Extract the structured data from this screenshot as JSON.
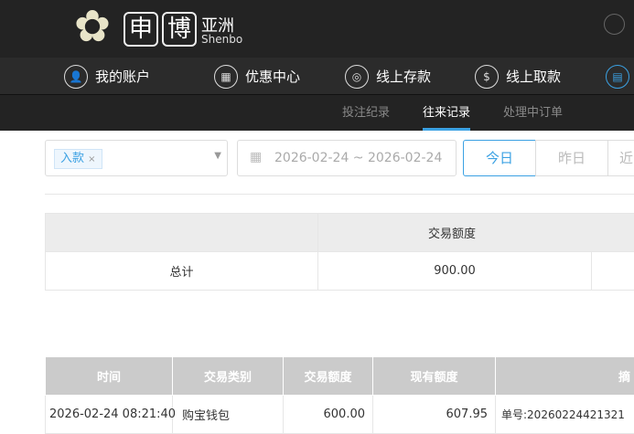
{
  "brand": {
    "logo_char1": "申",
    "logo_char2": "博",
    "region": "亚洲",
    "name_en": "Shenbo"
  },
  "nav": [
    {
      "label": "我的账户",
      "icon": "user-icon"
    },
    {
      "label": "优惠中心",
      "icon": "gift-icon"
    },
    {
      "label": "线上存款",
      "icon": "deposit-icon"
    },
    {
      "label": "线上取款",
      "icon": "withdraw-icon"
    }
  ],
  "subnav": [
    {
      "label": "投注纪录"
    },
    {
      "label": "往来记录",
      "active": true
    },
    {
      "label": "处理中订单"
    }
  ],
  "filter": {
    "type_tag": "入款",
    "date_range": "2026-02-24 ~ 2026-02-24",
    "today": "今日",
    "yesterday": "昨日",
    "more": "近"
  },
  "summary": {
    "header": "交易额度",
    "row_label": "总计",
    "amount": "900.00"
  },
  "table": {
    "headers": [
      "时间",
      "交易类别",
      "交易额度",
      "现有额度",
      "摘"
    ],
    "rows": [
      {
        "time": "2026-02-24 08:21:40",
        "type": "购宝钱包",
        "amount": "600.00",
        "balance": "607.95",
        "note": "单号:20260224421321"
      }
    ]
  },
  "colors": {
    "accent": "#3ba1e3",
    "header_bg": "#232323"
  }
}
